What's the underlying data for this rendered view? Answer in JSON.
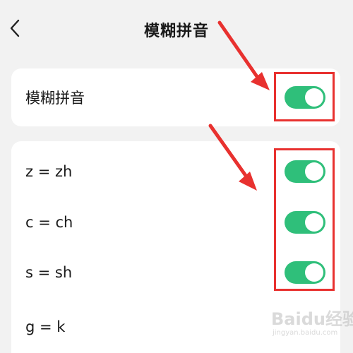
{
  "header": {
    "title": "模糊拼音",
    "back_icon": "chevron-left-icon"
  },
  "main_toggle": {
    "label": "模糊拼音",
    "on": true
  },
  "rules": [
    {
      "label": "z = zh",
      "on": true
    },
    {
      "label": "c = ch",
      "on": true
    },
    {
      "label": "s = sh",
      "on": true
    },
    {
      "label": "g = k",
      "on": null
    }
  ],
  "colors": {
    "switch_on": "#2fbf7a",
    "annotation": "#e8312f",
    "background": "#f2f2f2"
  },
  "watermark": {
    "brand": "Baidu经验",
    "url": "jingyan.baidu.com"
  }
}
